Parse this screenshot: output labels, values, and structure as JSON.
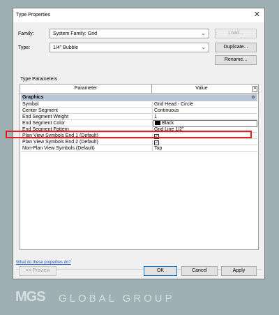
{
  "dialog": {
    "title": "Type Properties",
    "close_glyph": "✕",
    "family_label": "Family:",
    "family_value": "System Family: Grid",
    "type_label": "Type:",
    "type_value": "1/4\" Bubble",
    "load_button": "Load...",
    "duplicate_button": "Duplicate...",
    "rename_button": "Rename...",
    "type_parameters_label": "Type Parameters",
    "column_parameter": "Parameter",
    "column_value": "Value",
    "column_button": "=",
    "group_name": "Graphics",
    "group_collapse_glyph": "≎",
    "rows": [
      {
        "parameter": "Symbol",
        "value": "Grid Head - Circle"
      },
      {
        "parameter": "Center Segment",
        "value": "Continuous"
      },
      {
        "parameter": "End Segment Weight",
        "value": "1"
      },
      {
        "parameter": "End Segment Color",
        "value": "Black"
      },
      {
        "parameter": "End Segment Pattern",
        "value": "Grid Line 1/2\""
      },
      {
        "parameter": "Plan View Symbols End 1 (Default)",
        "value": "✓",
        "checked": true
      },
      {
        "parameter": "Plan View Symbols End 2 (Default)",
        "value": "✓",
        "checked": true
      },
      {
        "parameter": "Non-Plan View Symbols (Default)",
        "value": "Top"
      }
    ],
    "end_segment_color_swatch": "#000000",
    "highlight_color": "#e02020",
    "help_link": "What do these properties do?",
    "preview_button": "<< Preview",
    "ok_button": "OK",
    "cancel_button": "Cancel",
    "apply_button": "Apply"
  },
  "watermark": {
    "logo": "MGS",
    "text": "GLOBAL GROUP"
  }
}
